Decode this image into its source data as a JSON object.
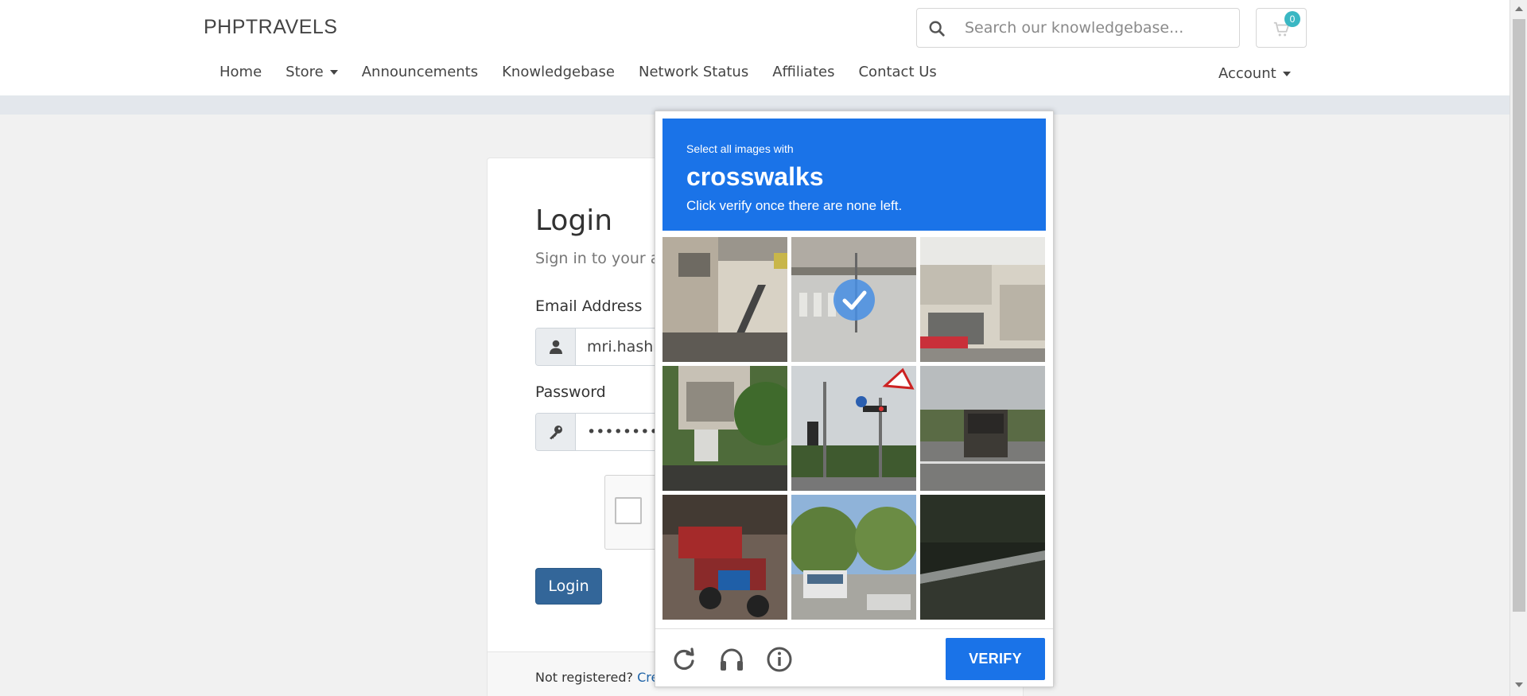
{
  "header": {
    "brand": "PHPTRAVELS",
    "search_placeholder": "Search our knowledgebase...",
    "cart_count": "0"
  },
  "nav": {
    "items": [
      "Home",
      "Store",
      "Announcements",
      "Knowledgebase",
      "Network Status",
      "Affiliates",
      "Contact Us"
    ],
    "account": "Account"
  },
  "login": {
    "title": "Login",
    "subtitle": "Sign in to your a",
    "email_label": "Email Address",
    "email_value": "mri.hashn",
    "password_label": "Password",
    "password_value": "••••••••••••",
    "button": "Login",
    "footer_text": "Not registered?",
    "footer_link": "Crea"
  },
  "recaptcha": {
    "prompt_small": "Select all images with",
    "prompt_target": "crosswalks",
    "prompt_hint": "Click verify once there are none left.",
    "verify_label": "VERIFY",
    "header_color": "#1a73e8",
    "tiles": [
      {
        "name": "tile-building-stairs",
        "selected": false
      },
      {
        "name": "tile-intersection-crosswalk",
        "selected": true
      },
      {
        "name": "tile-street-shops",
        "selected": false
      },
      {
        "name": "tile-garden-wall",
        "selected": false
      },
      {
        "name": "tile-traffic-lights",
        "selected": false
      },
      {
        "name": "tile-truck-road",
        "selected": false
      },
      {
        "name": "tile-motorcycles",
        "selected": false
      },
      {
        "name": "tile-bus-trees",
        "selected": false
      },
      {
        "name": "tile-dark-guardrail",
        "selected": false
      }
    ],
    "icons": [
      "reload-icon",
      "audio-icon",
      "info-icon"
    ]
  }
}
